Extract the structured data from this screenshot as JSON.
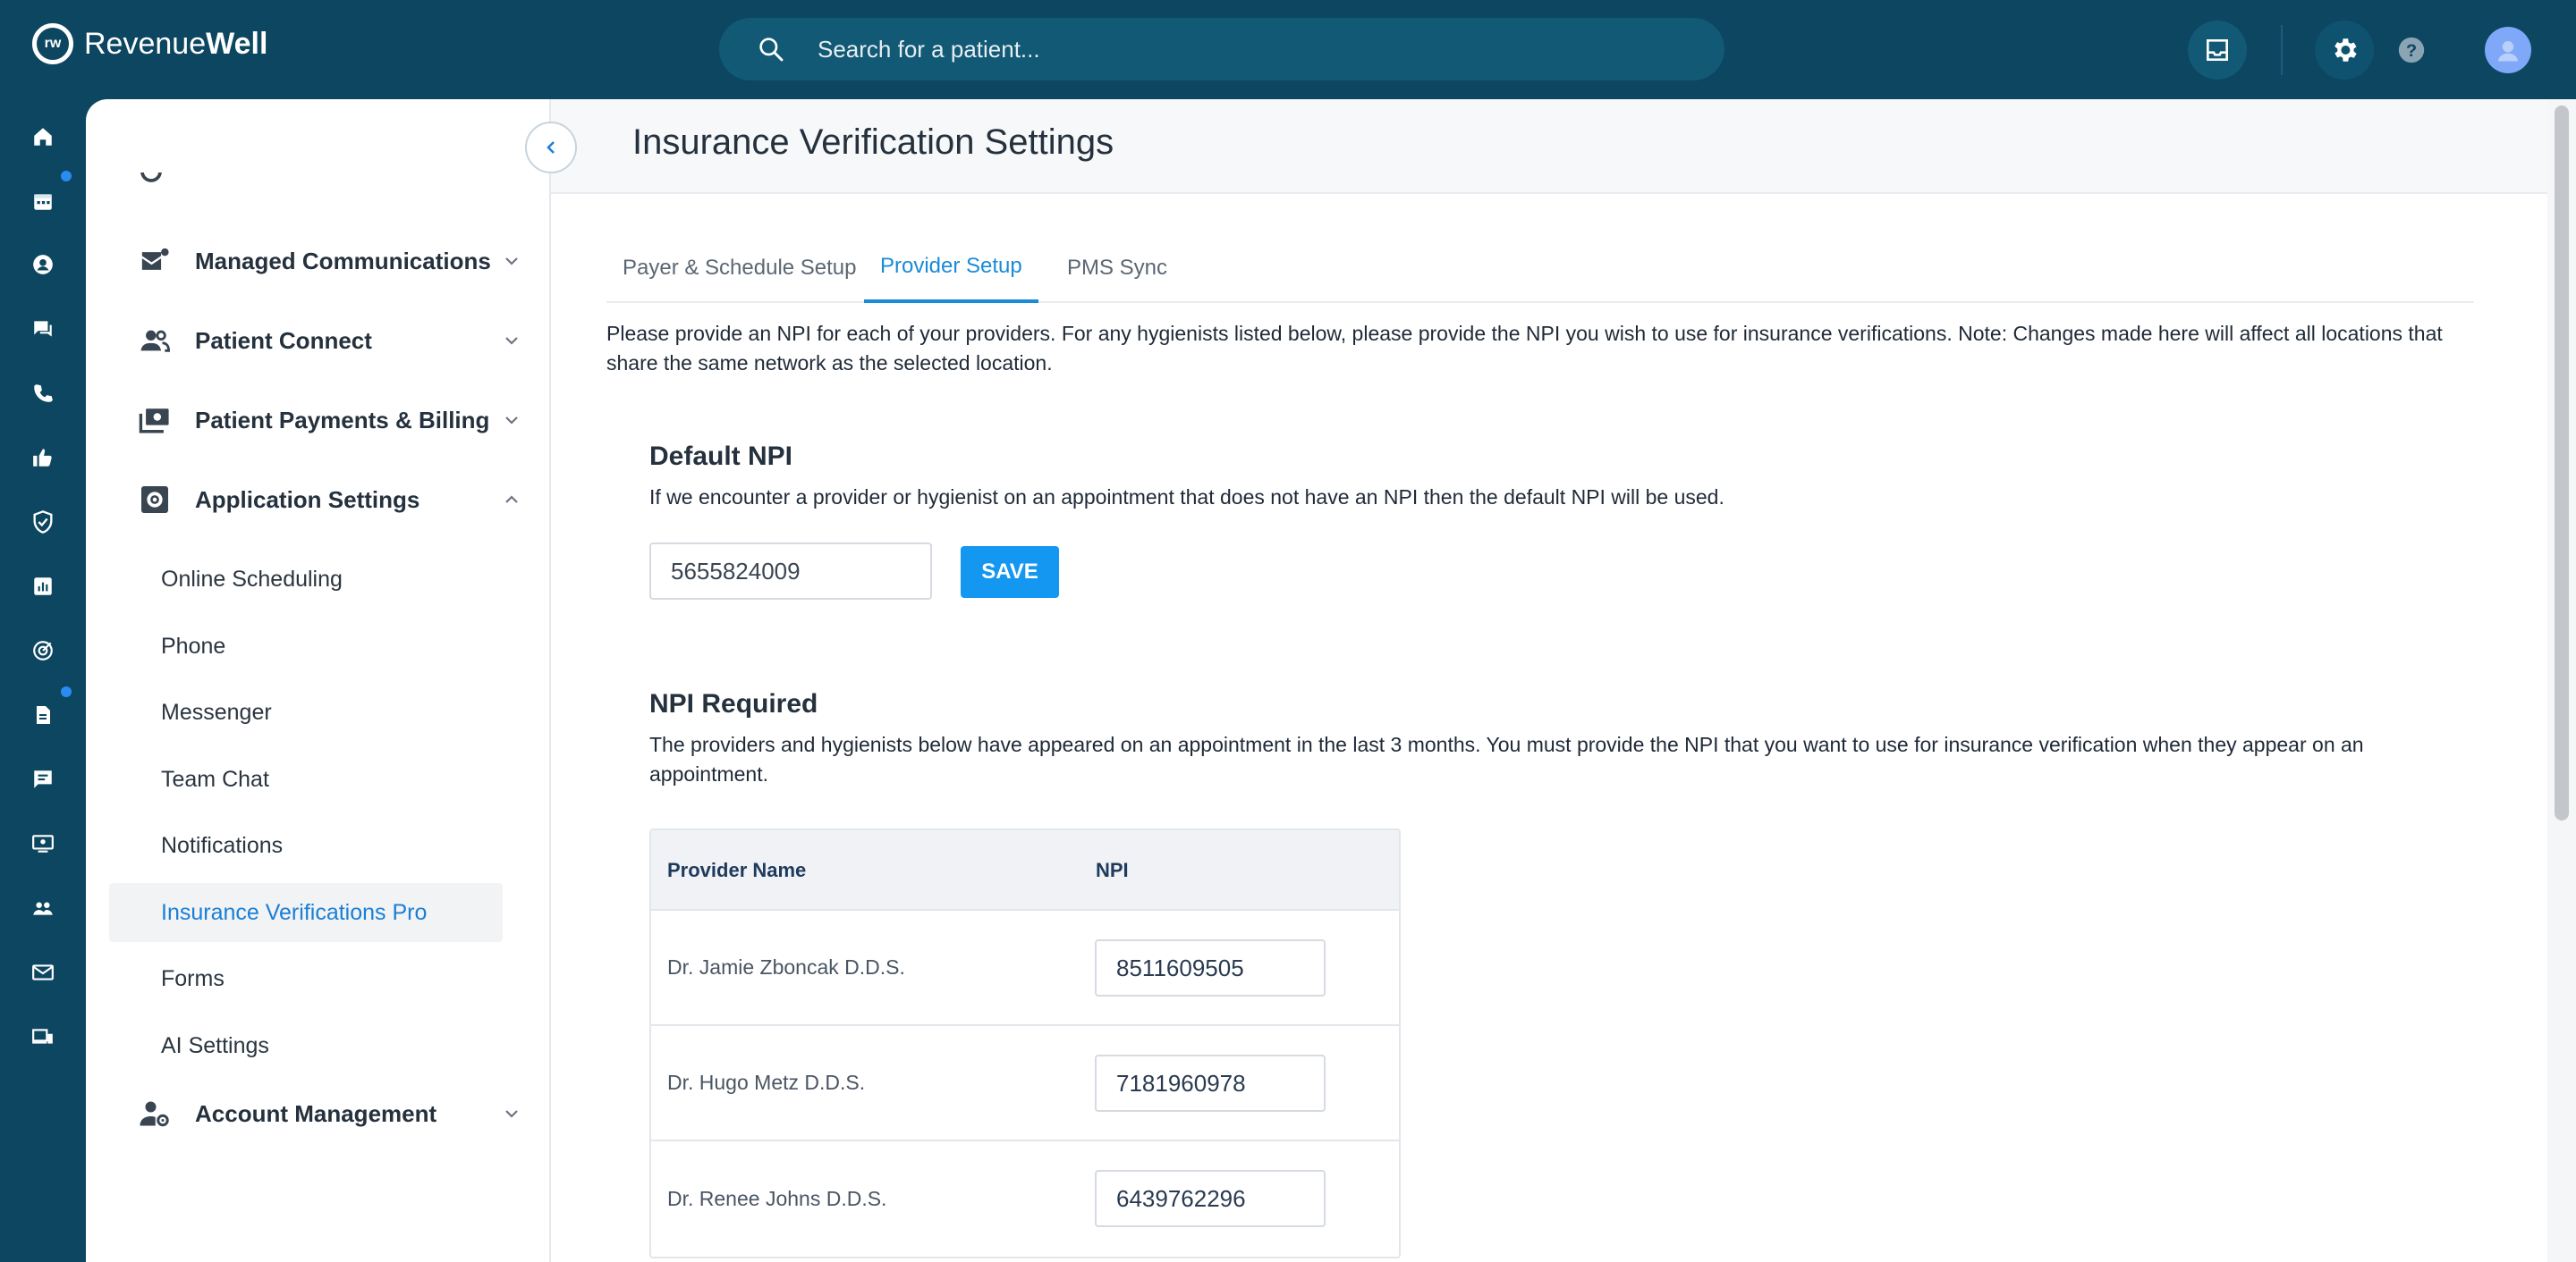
{
  "app": {
    "brand_light": "Revenue",
    "brand_bold": "Well",
    "logo_mark": "rw"
  },
  "search": {
    "placeholder": "Search for a patient..."
  },
  "colors": {
    "topbar": "#0c4660",
    "accent": "#1a8bd8",
    "save": "#1397f0"
  },
  "nav": {
    "sections": [
      {
        "label": "Managed Communications",
        "icon": "mail-icon"
      },
      {
        "label": "Patient Connect",
        "icon": "people-icon"
      },
      {
        "label": "Patient Payments & Billing",
        "icon": "payments-icon"
      },
      {
        "label": "Application Settings",
        "icon": "settings-icon"
      },
      {
        "label": "Account Management",
        "icon": "account-gear-icon"
      }
    ],
    "sub_items": [
      "Online Scheduling",
      "Phone",
      "Messenger",
      "Team Chat",
      "Notifications",
      "Insurance Verifications Pro",
      "Forms",
      "AI Settings"
    ]
  },
  "page": {
    "title": "Insurance Verification Settings",
    "tabs": [
      "Payer & Schedule Setup",
      "Provider Setup",
      "PMS Sync"
    ],
    "active_tab": "Provider Setup",
    "description": "Please provide an NPI for each of your providers. For any hygienists listed below, please provide the NPI you wish to use for insurance verifications. Note: Changes made here will affect all locations that share the same network as the selected location."
  },
  "default_npi": {
    "heading": "Default NPI",
    "subtext": "If we encounter a provider or hygienist on an appointment that does not have an NPI then the default NPI will be used.",
    "value": "5655824009",
    "save_label": "SAVE"
  },
  "npi_required": {
    "heading": "NPI Required",
    "subtext": "The providers and hygienists below have appeared on an appointment in the last 3 months. You must provide the NPI that you want to use for insurance verification when they appear on an appointment.",
    "columns": [
      "Provider Name",
      "NPI"
    ],
    "rows": [
      {
        "name": "Dr. Jamie Zboncak D.D.S.",
        "npi": "8511609505"
      },
      {
        "name": "Dr. Hugo Metz D.D.S.",
        "npi": "7181960978"
      },
      {
        "name": "Dr. Renee Johns D.D.S.",
        "npi": "6439762296"
      }
    ]
  }
}
